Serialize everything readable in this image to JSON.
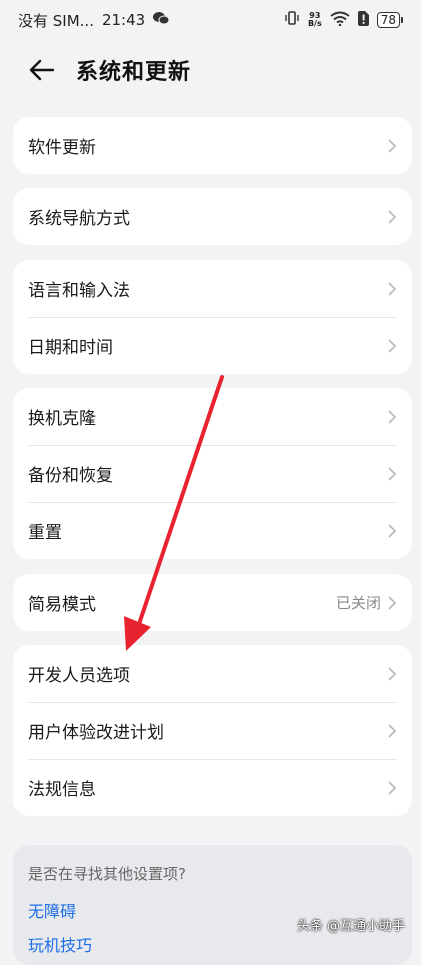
{
  "status_bar": {
    "carrier": "没有 SIM...",
    "time": "21:43",
    "net_speed_value": "93",
    "net_speed_unit": "B/s",
    "battery": "78"
  },
  "header": {
    "title": "系统和更新"
  },
  "groups": [
    {
      "items": [
        {
          "label": "软件更新"
        }
      ]
    },
    {
      "items": [
        {
          "label": "系统导航方式"
        }
      ]
    },
    {
      "items": [
        {
          "label": "语言和输入法"
        },
        {
          "label": "日期和时间"
        }
      ]
    },
    {
      "items": [
        {
          "label": "换机克隆"
        },
        {
          "label": "备份和恢复"
        },
        {
          "label": "重置"
        }
      ]
    },
    {
      "items": [
        {
          "label": "简易模式",
          "value": "已关闭"
        }
      ]
    },
    {
      "items": [
        {
          "label": "开发人员选项"
        },
        {
          "label": "用户体验改进计划"
        },
        {
          "label": "法规信息"
        }
      ]
    }
  ],
  "search_more": {
    "title": "是否在寻找其他设置项?",
    "links": [
      "无障碍",
      "玩机技巧"
    ]
  },
  "watermark": "头条 @互通小助手",
  "colors": {
    "background": "#f1f3f5",
    "card": "#ffffff",
    "link": "#1e6ee6",
    "annotation_arrow": "#e8222e"
  }
}
